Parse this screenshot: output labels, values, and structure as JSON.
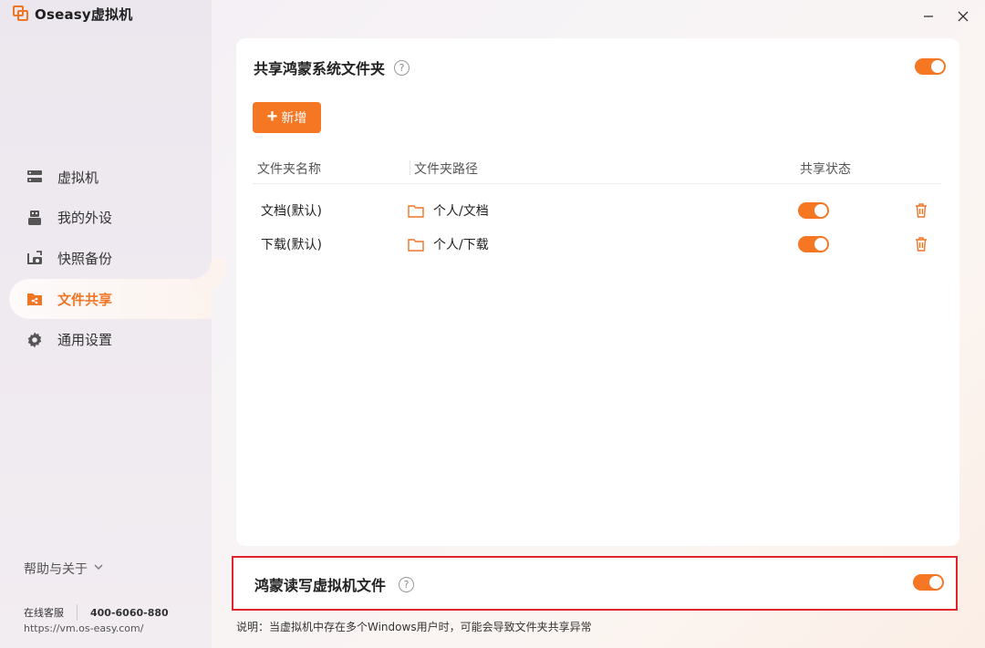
{
  "app": {
    "title": "Oseasy虚拟机"
  },
  "sidebar": {
    "items": [
      {
        "label": "虚拟机",
        "icon": "server-icon",
        "active": false
      },
      {
        "label": "我的外设",
        "icon": "usb-icon",
        "active": false
      },
      {
        "label": "快照备份",
        "icon": "snapshot-icon",
        "active": false
      },
      {
        "label": "文件共享",
        "icon": "folder-share-icon",
        "active": true
      },
      {
        "label": "通用设置",
        "icon": "gear-icon",
        "active": false
      }
    ],
    "help_label": "帮助与关于",
    "contact_label": "在线客服",
    "phone": "400-6060-880",
    "url": "https://vm.os-easy.com/"
  },
  "main": {
    "title": "共享鸿蒙系统文件夹",
    "add_button": "新增",
    "columns": [
      "文件夹名称",
      "文件夹路径",
      "共享状态"
    ],
    "rows": [
      {
        "name": "文档(默认)",
        "path": "个人/文档",
        "shared": true
      },
      {
        "name": "下载(默认)",
        "path": "个人/下载",
        "shared": true
      }
    ]
  },
  "panel2": {
    "title": "鸿蒙读写虚拟机文件"
  },
  "note": "说明：当虚拟机中存在多个Windows用户时，可能会导致文件夹共享异常",
  "colors": {
    "accent": "#f57623",
    "highlight_border": "#e2252b"
  }
}
